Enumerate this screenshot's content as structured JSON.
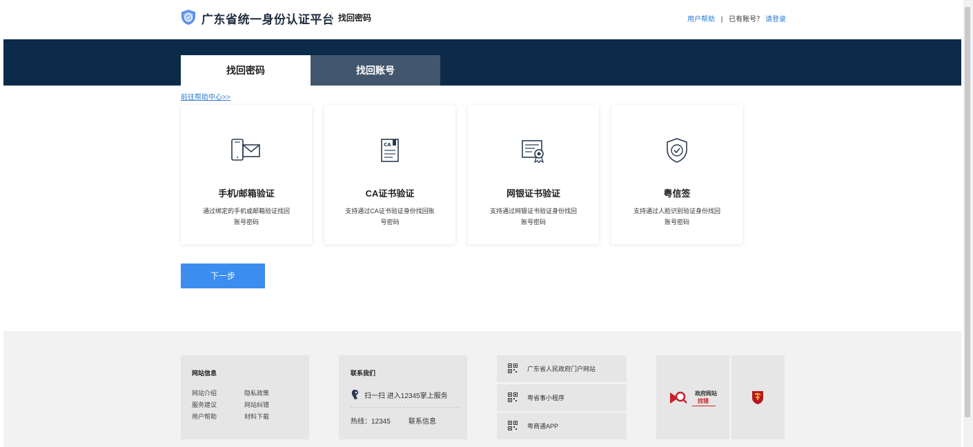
{
  "header": {
    "site_title": "广东省统一身份认证平台",
    "page_name": "找回密码",
    "help_link": "用户帮助",
    "separator": "|",
    "has_account": "已有账号？",
    "login_link": "请登录"
  },
  "tabs": [
    {
      "label": "找回密码",
      "active": true
    },
    {
      "label": "找回账号",
      "active": false
    }
  ],
  "help_center_link": "前往帮助中心>>",
  "cards": [
    {
      "icon": "phone-mail-icon",
      "title": "手机/邮箱验证",
      "desc_line1": "通过绑定的手机或邮箱验证找回",
      "desc_line2": "账号密码"
    },
    {
      "icon": "ca-certificate-icon",
      "title": "CA证书验证",
      "desc_line1": "支持通过CA证书验证身份找回账",
      "desc_line2": "号密码"
    },
    {
      "icon": "bank-certificate-icon",
      "title": "网银证书验证",
      "desc_line1": "支持通过网银证书验证身份找回",
      "desc_line2": "账号密码"
    },
    {
      "icon": "shield-check-icon",
      "title": "粤信签",
      "desc_line1": "支持通过人脸识别验证身份找回",
      "desc_line2": "账号密码"
    }
  ],
  "next_button": "下一步",
  "footer": {
    "site_info": {
      "title": "网站信息",
      "links": [
        "网站介绍",
        "隐私政策",
        "服务建议",
        "网站纠错",
        "用户帮助",
        "材料下载"
      ]
    },
    "contact": {
      "title": "联系我们",
      "scan_text": "扫一扫 进入12345掌上服务",
      "hotline": "热线：12345",
      "contact_info": "联系信息"
    },
    "qr_links": [
      "广东省人民政府门户网站",
      "粤省事小程序",
      "粤商通APP"
    ],
    "gov_badge": {
      "line1": "政府网站",
      "line2": "找错"
    }
  },
  "colors": {
    "banner": "#0c2a4a",
    "tab_inactive": "#42576d",
    "primary_button": "#3b8df0",
    "link": "#2b7bd8"
  }
}
